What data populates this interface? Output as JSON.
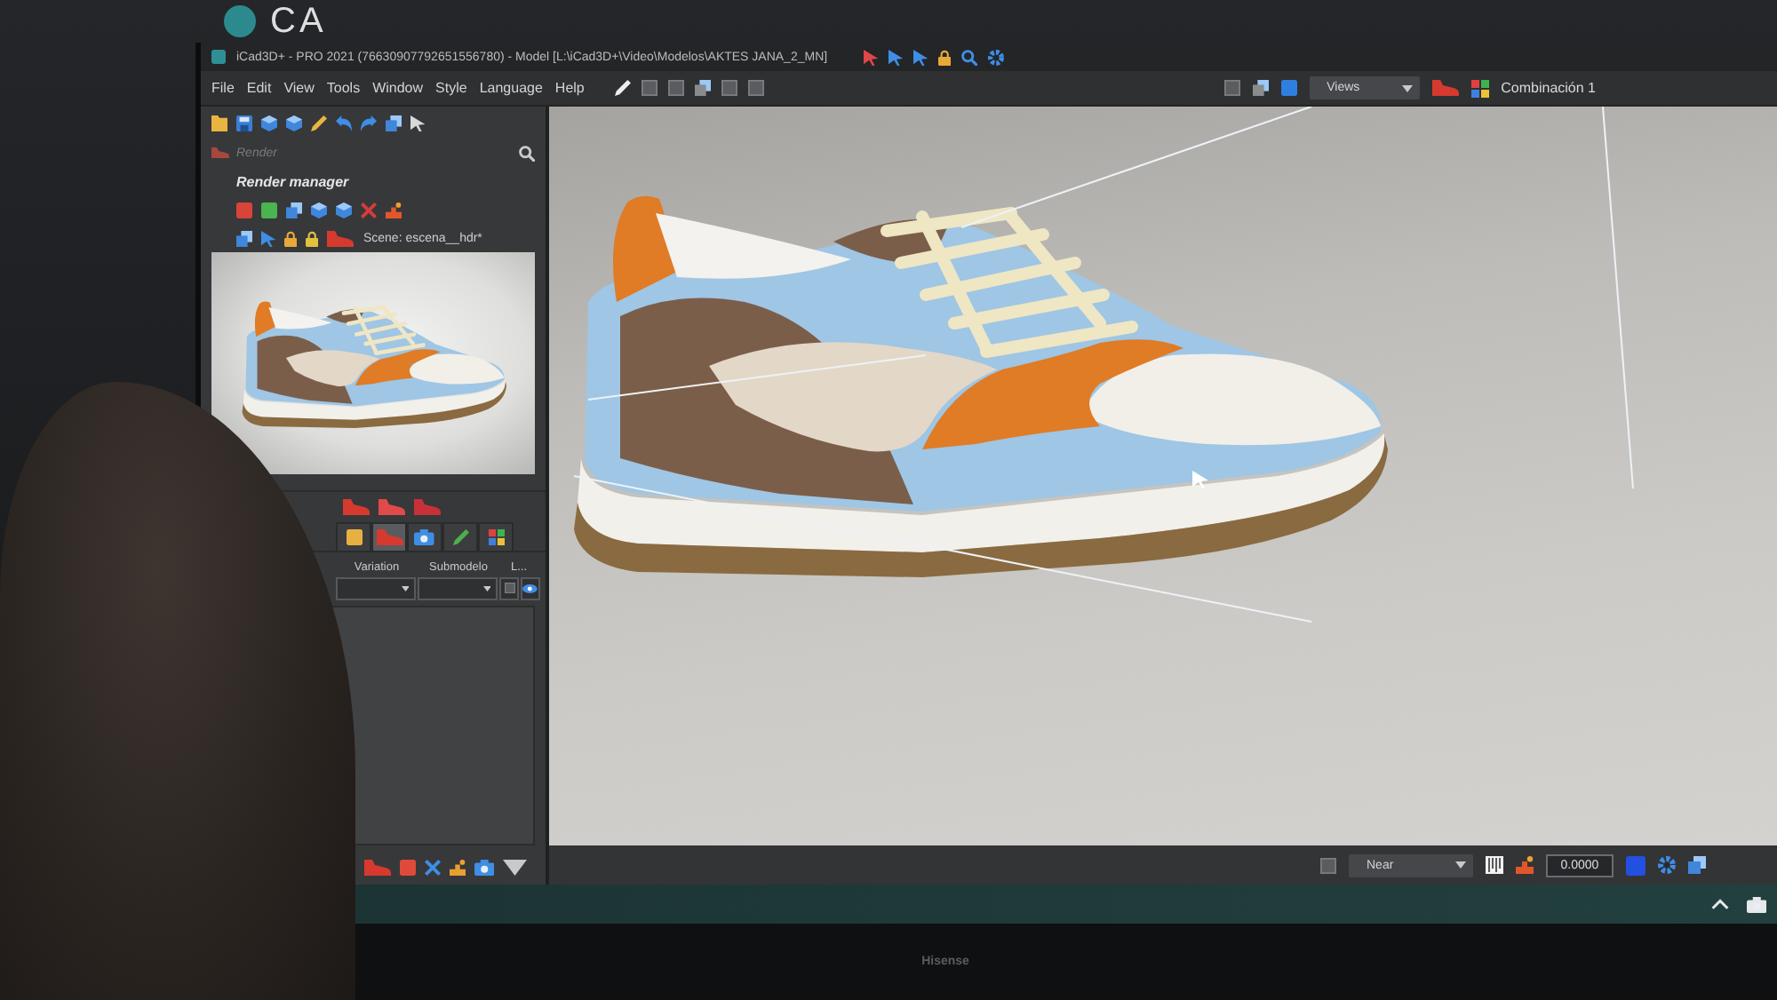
{
  "logo": {
    "text": "CA"
  },
  "window": {
    "title": "iCad3D+ - PRO 2021 (76630907792651556780) - Model [L:\\iCad3D+\\Video\\Modelos\\AKTES JANA_2_MN]"
  },
  "menu": [
    "File",
    "Edit",
    "View",
    "Tools",
    "Window",
    "Style",
    "Language",
    "Help"
  ],
  "toolbar": {
    "views_dropdown": "Views",
    "combination": "Combinación 1"
  },
  "render_panel": {
    "tab": "Render",
    "title": "Render manager",
    "scene": "Scene: escena__hdr*"
  },
  "variations_panel": {
    "icon_tabs": [
      {
        "selected": false
      },
      {
        "selected": true
      },
      {
        "selected": false
      },
      {
        "selected": false
      },
      {
        "selected": false
      }
    ],
    "columns": [
      "Variation",
      "Submodelo",
      "L..."
    ]
  },
  "status_bar": {
    "snap_mode": "Near",
    "value": "0.0000"
  },
  "monitor": {
    "brand": "Hisense"
  }
}
